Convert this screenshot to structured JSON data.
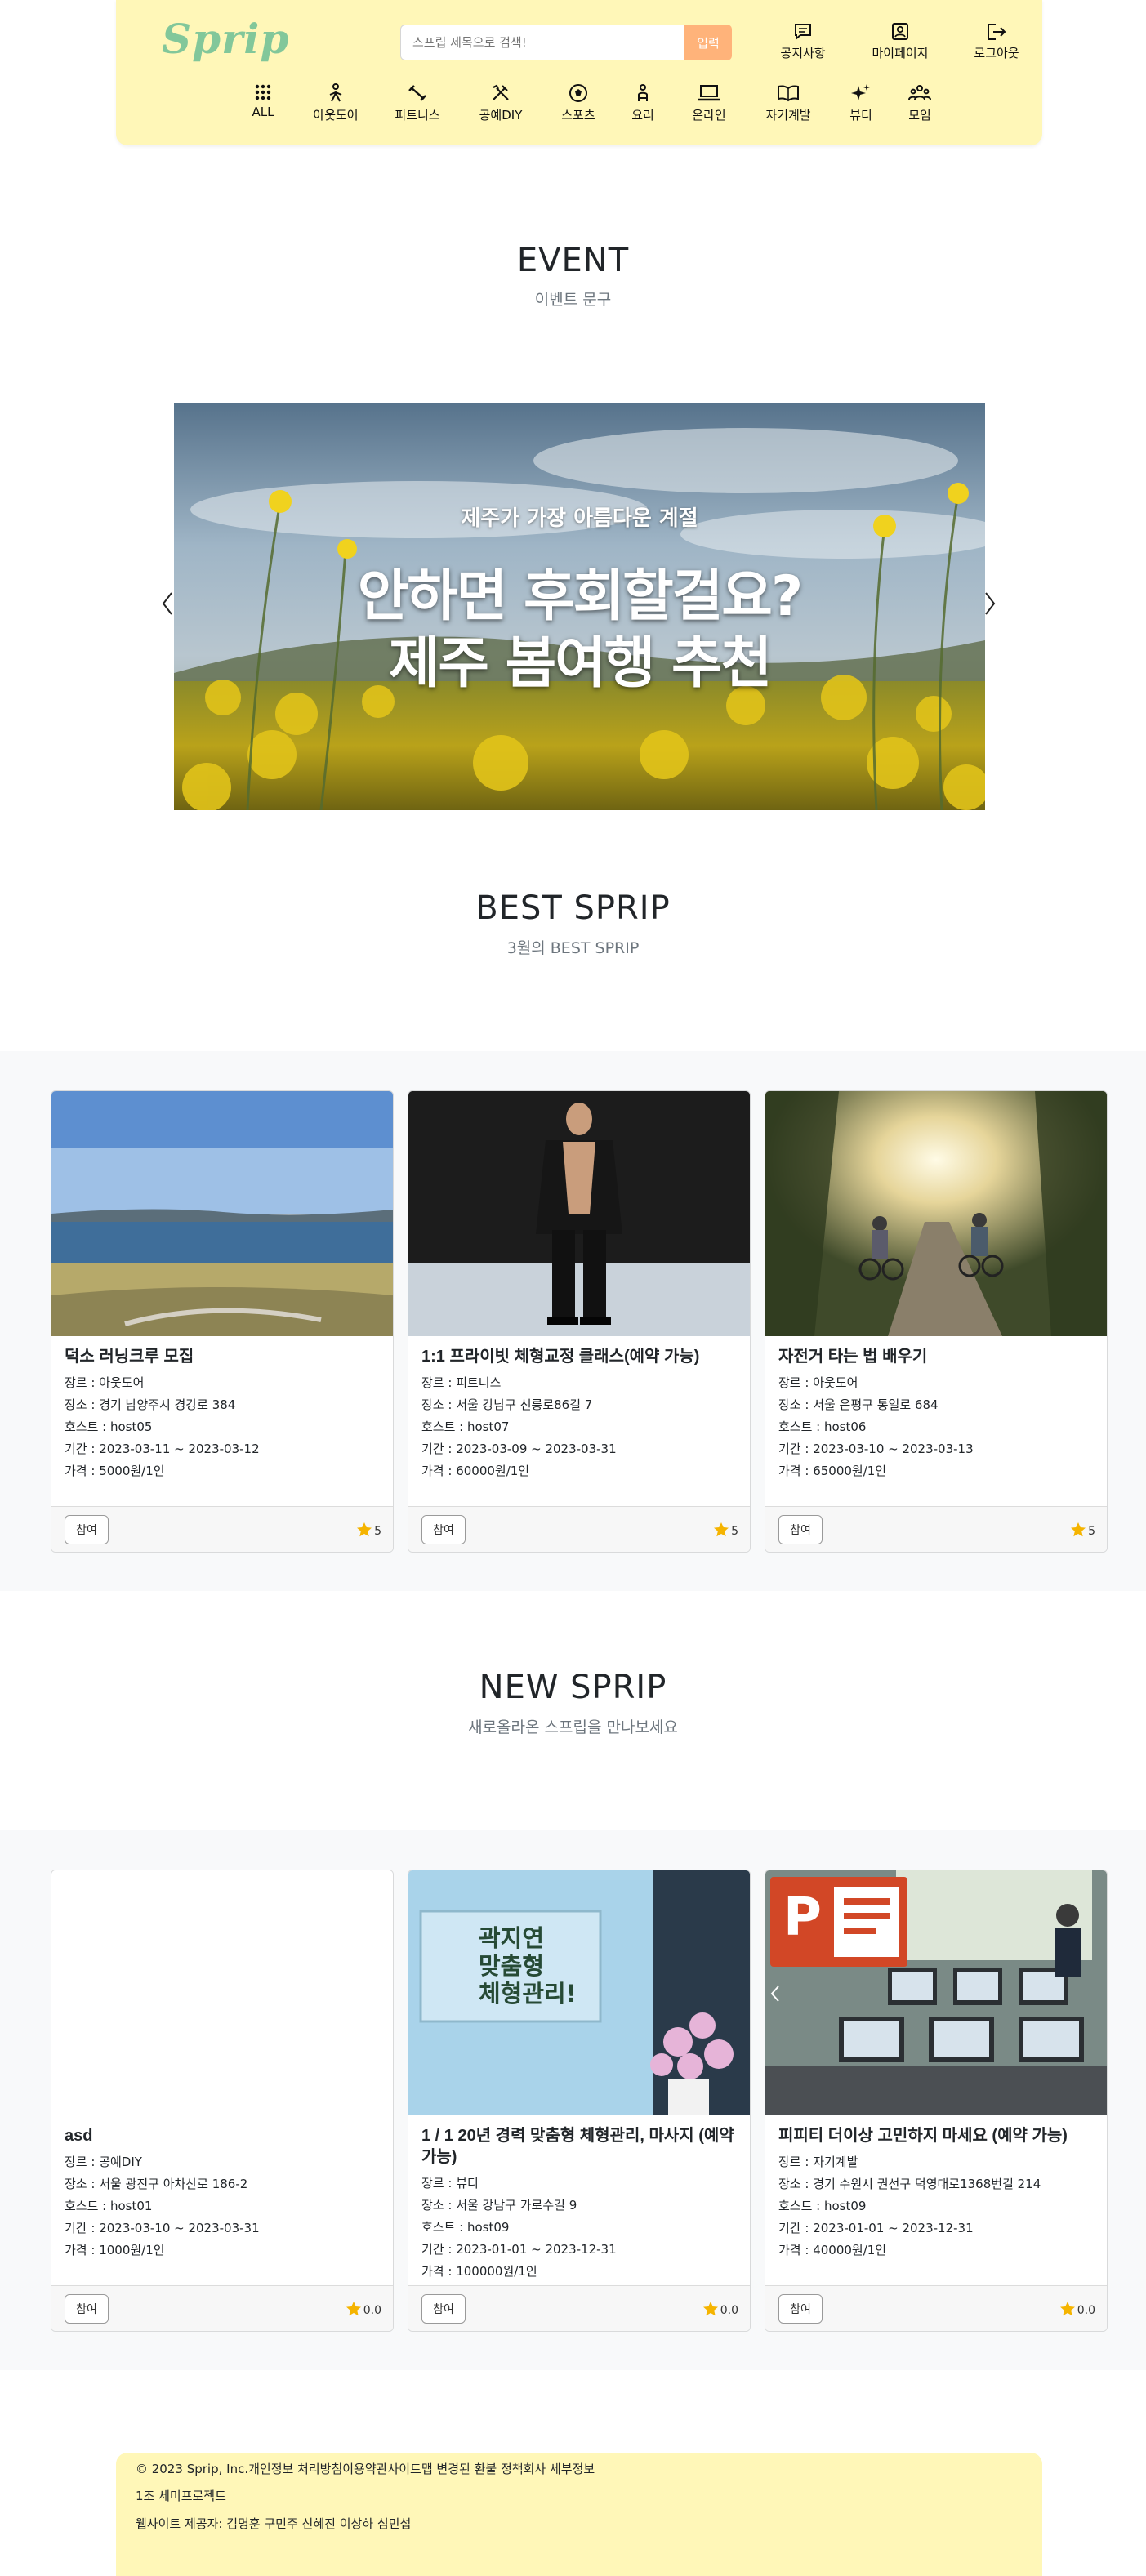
{
  "header": {
    "logo": "Sprip",
    "search": {
      "placeholder": "스프립 제목으로 검색!",
      "button_label": "입력"
    },
    "top_nav": [
      {
        "label": "공지사항",
        "icon": "notice-icon"
      },
      {
        "label": "마이페이지",
        "icon": "profile-icon"
      },
      {
        "label": "로그아웃",
        "icon": "logout-icon"
      }
    ],
    "categories": [
      {
        "label": "ALL",
        "icon": "grid-icon"
      },
      {
        "label": "아웃도어",
        "icon": "hiking-icon"
      },
      {
        "label": "피트니스",
        "icon": "dumbbell-icon"
      },
      {
        "label": "공예DIY",
        "icon": "tools-icon"
      },
      {
        "label": "스포츠",
        "icon": "ball-icon"
      },
      {
        "label": "요리",
        "icon": "chef-icon"
      },
      {
        "label": "온라인",
        "icon": "laptop-icon"
      },
      {
        "label": "자기계발",
        "icon": "book-icon"
      },
      {
        "label": "뷰티",
        "icon": "sparkle-icon"
      },
      {
        "label": "모임",
        "icon": "people-icon"
      }
    ]
  },
  "event": {
    "title": "EVENT",
    "subtitle": "이벤트 문구",
    "banner": {
      "kicker": "제주가 가장 아름다운 계절",
      "line1": "안하면 후회할걸요?",
      "line2": "제주 봄여행 추천"
    }
  },
  "best": {
    "title": "BEST SPRIP",
    "subtitle": "3월의 BEST SPRIP",
    "cards": [
      {
        "title": "덕소 러닝크루 모집",
        "genre": "장르 : 아웃도어",
        "place": "장소 : 경기 남양주시 경강로 384",
        "host": "호스트 : host05",
        "period": "기간 : 2023-03-11 ~ 2023-03-12",
        "price": "가격 : 5000원/1인",
        "join": "참여",
        "rating": "5"
      },
      {
        "title": "1:1 프라이빗 체형교정 클래스(예약 가능)",
        "genre": "장르 : 피트니스",
        "place": "장소 : 서울 강남구 선릉로86길 7",
        "host": "호스트 : host07",
        "period": "기간 : 2023-03-09 ~ 2023-03-31",
        "price": "가격 : 60000원/1인",
        "join": "참여",
        "rating": "5"
      },
      {
        "title": "자전거 타는 법 배우기",
        "genre": "장르 : 아웃도어",
        "place": "장소 : 서울 은평구 통일로 684",
        "host": "호스트 : host06",
        "period": "기간 : 2023-03-10 ~ 2023-03-13",
        "price": "가격 : 65000원/1인",
        "join": "참여",
        "rating": "5"
      }
    ]
  },
  "new": {
    "title": "NEW SPRIP",
    "subtitle": "새로올라온 스프립을 만나보세요",
    "cards": [
      {
        "title": "asd",
        "genre": "장르 : 공예DIY",
        "place": "장소 : 서울 광진구 아차산로 186-2",
        "host": "호스트 : host01",
        "period": "기간 : 2023-03-10 ~ 2023-03-31",
        "price": "가격 : 1000원/1인",
        "join": "참여",
        "rating": "0.0"
      },
      {
        "title": "1 / 1 20년 경력 맞춤형 체형관리, 마사지 (예약 가능)",
        "genre": "장르 : 뷰티",
        "place": "장소 : 서울 강남구 가로수길 9",
        "host": "호스트 : host09",
        "period": "기간 : 2023-01-01 ~ 2023-12-31",
        "price": "가격 : 100000원/1인",
        "join": "참여",
        "rating": "0.0",
        "sign": [
          "곽지연",
          "맞춤형",
          "체형관리!"
        ]
      },
      {
        "title": "피피티 더이상 고민하지 마세요 (예약 가능)",
        "genre": "장르 : 자기계발",
        "place": "장소 : 경기 수원시 권선구 덕영대로1368번길 214",
        "host": "호스트 : host09",
        "period": "기간 : 2023-01-01 ~ 2023-12-31",
        "price": "가격 : 40000원/1인",
        "join": "참여",
        "rating": "0.0",
        "logo_letter": "P"
      }
    ]
  },
  "footer": {
    "line1": "© 2023 Sprip, Inc.개인정보 처리방침이용약관사이트맵 변경된 환불 정책회사 세부정보",
    "line2": "1조 세미프로젝트",
    "line3": "웹사이트 제공자: 김명훈 구민주 신혜진 이상하 심민섭"
  },
  "colors": {
    "header_bg": "#fff7b8",
    "logo": "#82c79a",
    "search_button": "#ffb37a",
    "band_bg": "#f8f9fa",
    "star": "#f5b400"
  }
}
